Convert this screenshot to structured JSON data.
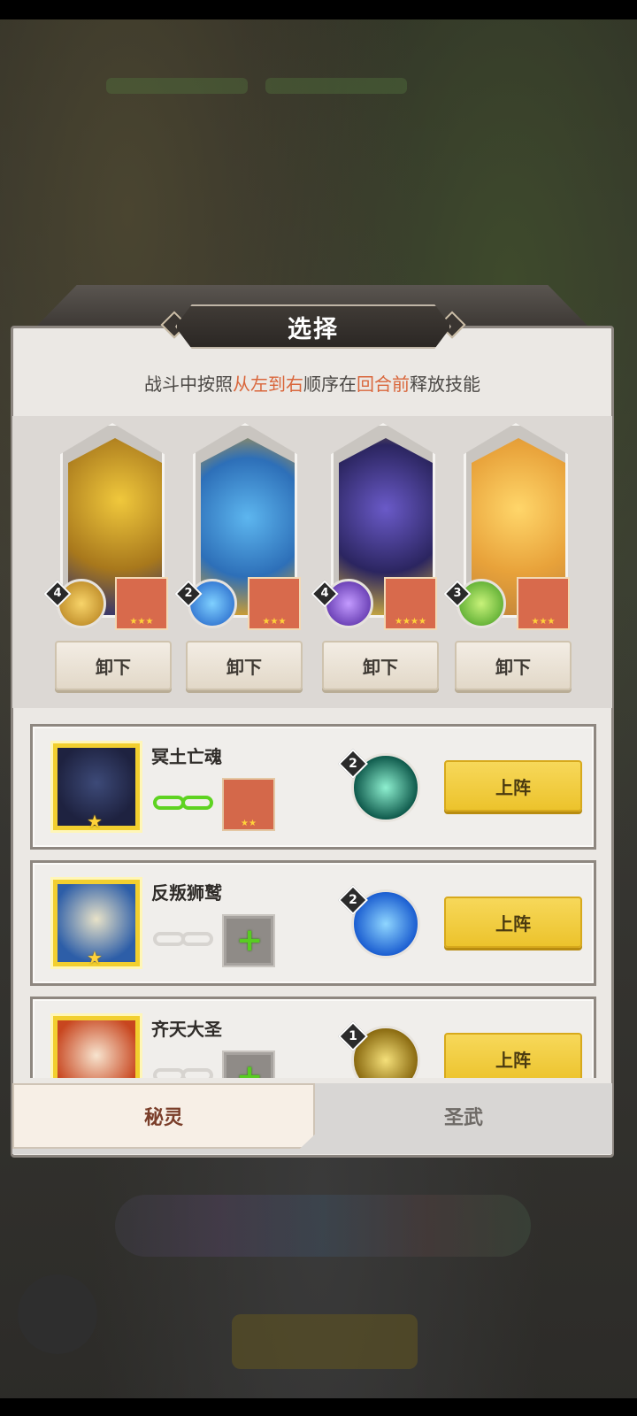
{
  "dialog": {
    "title": "选择",
    "instruction_prefix": "战斗中按照",
    "instruction_hl1": "从左到右",
    "instruction_mid": "顺序在",
    "instruction_hl2": "回合前",
    "instruction_suffix": "释放技能"
  },
  "slots": [
    {
      "level": "4",
      "button": "卸下",
      "skill_icon": "gold-trident-skill-icon",
      "art": "golden-armored-beast",
      "partner_stars": "★★★"
    },
    {
      "level": "2",
      "button": "卸下",
      "skill_icon": "blue-wave-skill-icon",
      "art": "blue-narwhal-beast",
      "partner_stars": "★★★"
    },
    {
      "level": "4",
      "button": "卸下",
      "skill_icon": "purple-vortex-skill-icon",
      "art": "dark-purple-wolf-beast",
      "partner_stars": "★★★★"
    },
    {
      "level": "3",
      "button": "卸下",
      "skill_icon": "green-spiral-skill-icon",
      "art": "golden-fox-beast",
      "partner_stars": "★★★"
    }
  ],
  "list": [
    {
      "name": "冥土亡魂",
      "level": "2",
      "button": "上阵",
      "linked": true,
      "partner_stars": "★★",
      "orb": "teal-spikes-skill-icon"
    },
    {
      "name": "反叛狮鹫",
      "level": "2",
      "button": "上阵",
      "linked": false,
      "orb": "blue-splash-skill-icon"
    },
    {
      "name": "齐天大圣",
      "level": "1",
      "button": "上阵",
      "linked": false,
      "orb": "gold-orb-skill-icon"
    }
  ],
  "tabs": {
    "active": "秘灵",
    "inactive": "圣武"
  },
  "colors": {
    "highlight": "#d9663b",
    "deploy": "#ecc32c",
    "link_on": "#5ed321"
  }
}
